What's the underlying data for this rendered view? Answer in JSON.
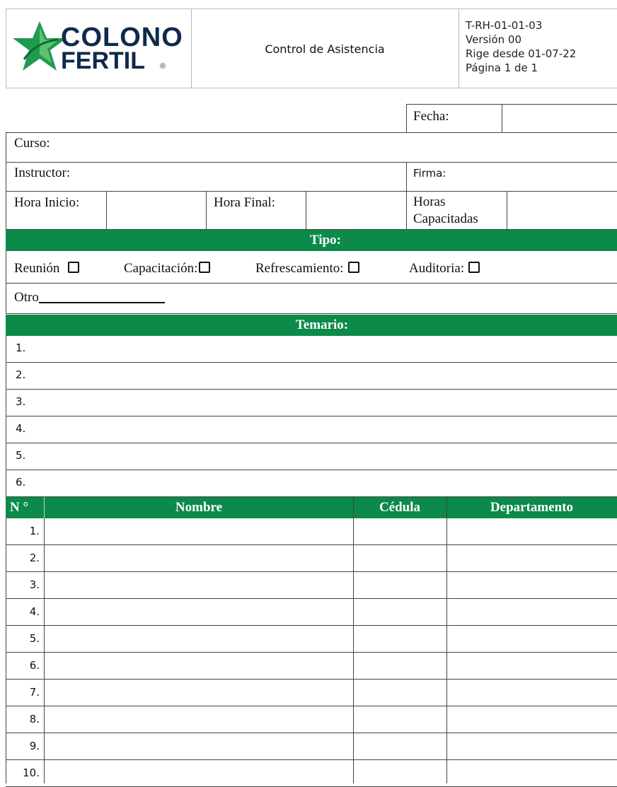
{
  "header": {
    "logo_line1": "COLONO",
    "logo_line2": "FERTIL",
    "logo_mark": "®",
    "title": "Control de Asistencia",
    "doc_code": "T-RH-01-01-03",
    "version": "Versión 00",
    "effective": "Rige desde 01-07-22",
    "page": "Página 1 de 1"
  },
  "form": {
    "fecha_label": "Fecha:",
    "curso_label": "Curso:",
    "instructor_label": "Instructor:",
    "firma_label": "Firma:",
    "hora_inicio_label": "Hora Inicio:",
    "hora_final_label": "Hora Final:",
    "horas_line1": "Horas",
    "horas_line2": "Capacitadas"
  },
  "tipo": {
    "header": "Tipo:",
    "options": [
      "Reunión",
      "Capacitación:",
      "Refrescamiento:",
      "Auditoria:"
    ],
    "otro": "Otro"
  },
  "temario": {
    "header": "Temario:",
    "items": [
      "1.",
      "2.",
      "3.",
      "4.",
      "5.",
      "6."
    ]
  },
  "attendance": {
    "columns": [
      "N °",
      "Nombre",
      "Cédula",
      "Departamento"
    ],
    "rows": [
      "1.",
      "2.",
      "3.",
      "4.",
      "5.",
      "6.",
      "7.",
      "8.",
      "9.",
      "10."
    ]
  },
  "colors": {
    "accent": "#0c8a4a",
    "logo_text": "#0f2a4a"
  }
}
